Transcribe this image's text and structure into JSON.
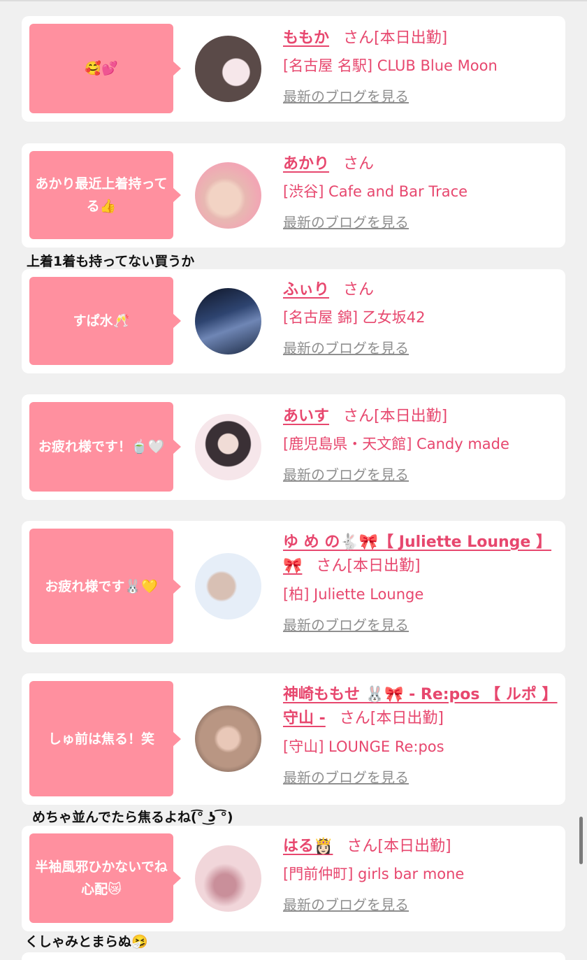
{
  "cards": [
    {
      "bubble": "🥰💕",
      "name": "ももか",
      "suffix": "さん[本日出勤]",
      "shop": "[名古屋 名駅] CLUB Blue Moon",
      "blog": "最新のブログを見る",
      "avatar_colors": [
        "#5a4a48",
        "#f6e7ea"
      ]
    },
    {
      "bubble": "あかり最近上着持ってる👍",
      "name": "あかり",
      "suffix": "さん",
      "shop": "[渋谷] Cafe and Bar Trace",
      "blog": "最新のブログを見る",
      "comment": "上着1着も持ってない買うか",
      "avatar_colors": [
        "#e8c7b5",
        "#f2a5b4"
      ]
    },
    {
      "bubble": "すぱ水🥂",
      "name": "ふぃり",
      "suffix": "さん",
      "shop": "[名古屋 錦] 乙女坂42",
      "blog": "最新のブログを見る",
      "avatar_colors": [
        "#1c2a44",
        "#6f86b5"
      ]
    },
    {
      "bubble": "お疲れ様です！🍵🤍",
      "name": "あいす",
      "suffix": "さん[本日出勤]",
      "shop": "[鹿児島県・天文館] Candy made",
      "blog": "最新のブログを見る",
      "avatar_colors": [
        "#f6e6ea",
        "#3a3035"
      ]
    },
    {
      "bubble": "お疲れ様です🐰💛",
      "name": "ゆ め の🐇🎀【 Juliette Lounge 】🎀",
      "suffix": "さん[本日出勤]",
      "shop": "[柏] Juliette Lounge",
      "blog": "最新のブログを見る",
      "avatar_colors": [
        "#e6eef8",
        "#d8c0b4"
      ]
    },
    {
      "bubble": "しゅ前は焦る！笑",
      "name": "神崎ももせ 🐰🎀 - Re:pos 【 ルポ 】守山 -",
      "suffix": "さん[本日出勤]",
      "shop": "[守山] LOUNGE Re:pos",
      "blog": "最新のブログを見る",
      "comment": "めちゃ並んでたら焦るよね(͡° ͜ʖ ͡°)",
      "avatar_colors": [
        "#b99683",
        "#4a3a33"
      ]
    },
    {
      "bubble": "半袖風邪ひかないでね心配😿",
      "name": "はる👸🏻",
      "suffix": "さん[本日出勤]",
      "shop": "[門前仲町] girls bar mone",
      "blog": "最新のブログを見る",
      "comment": "くしゃみとまらぬ🤧",
      "avatar_colors": [
        "#f1d6da",
        "#c98f9a"
      ]
    }
  ]
}
